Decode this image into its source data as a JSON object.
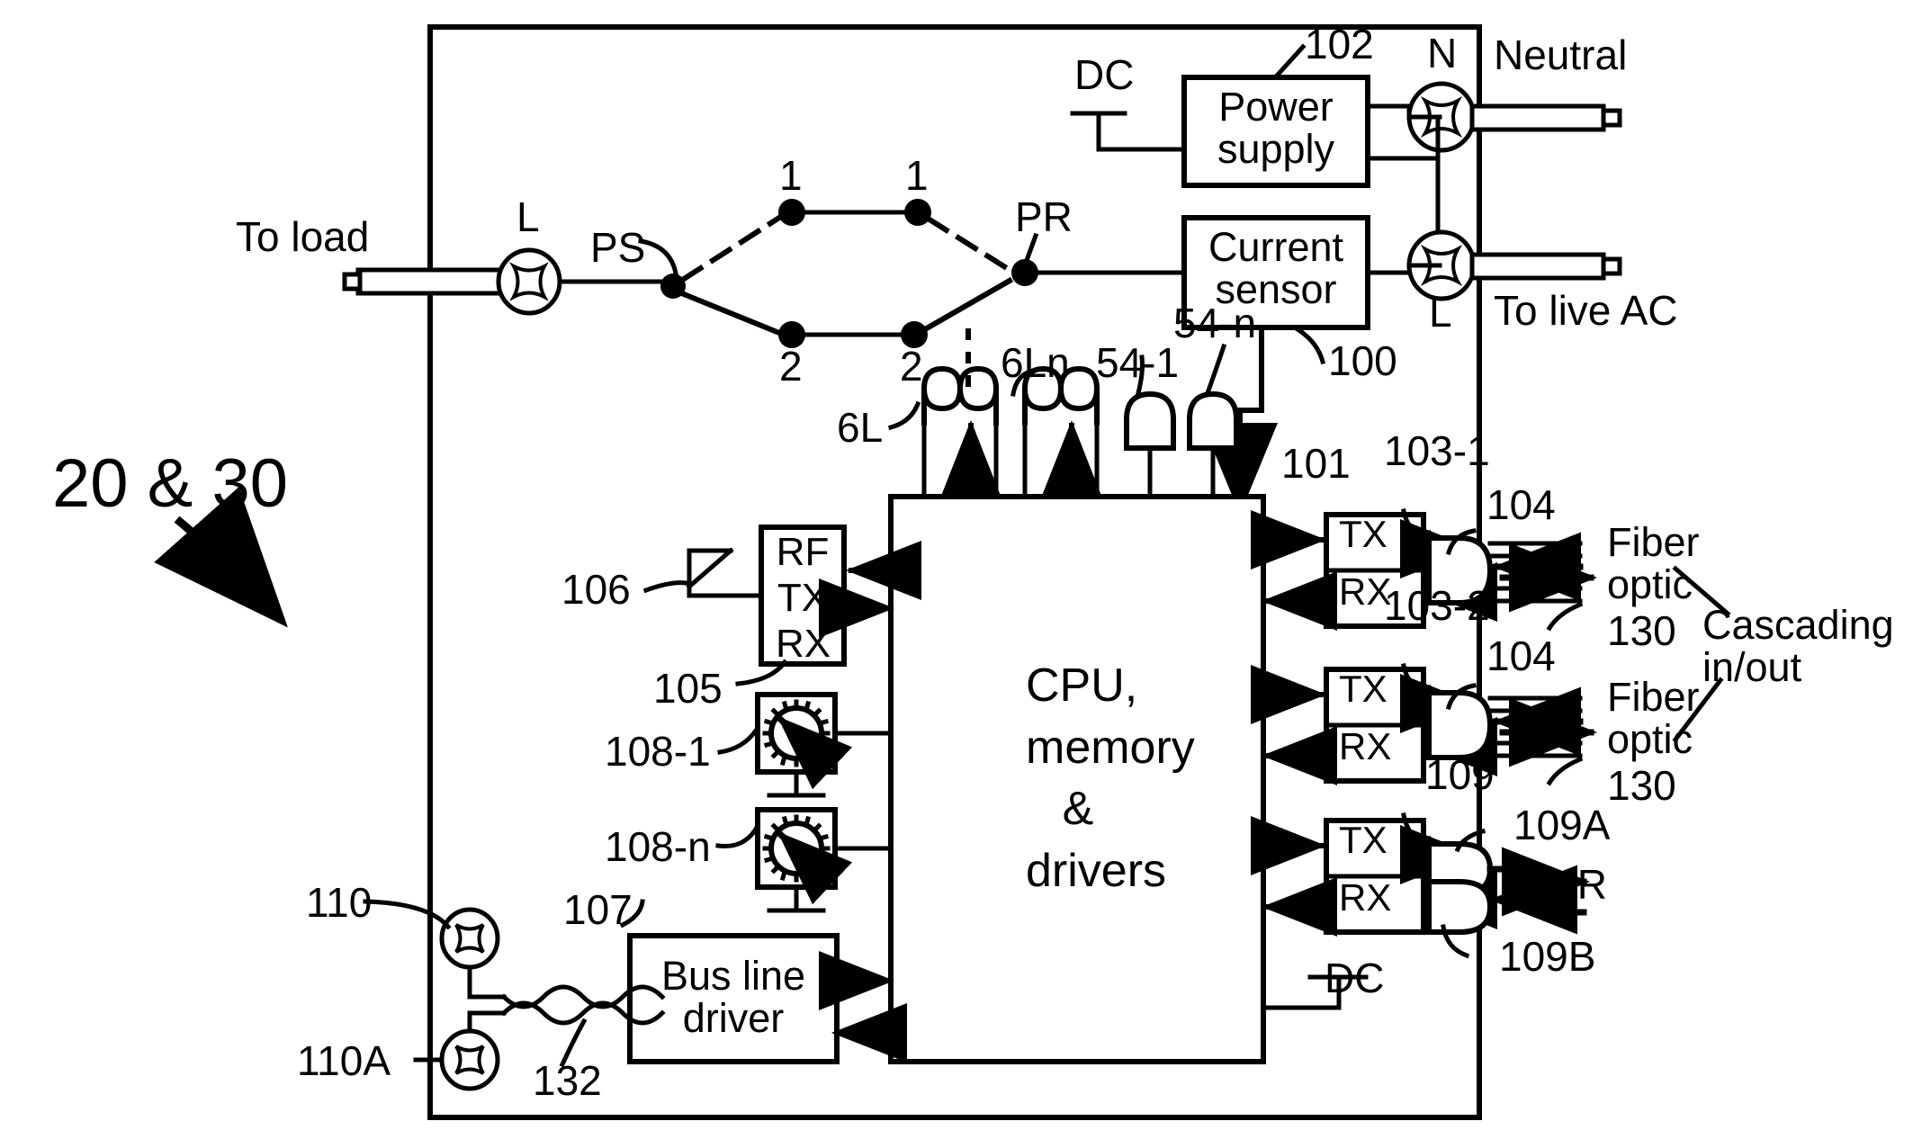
{
  "diagram": {
    "figure_ref": "20 & 30",
    "enclosure": {
      "name": "device-enclosure"
    },
    "power_line": {
      "to_load_label": "To load",
      "terminal_l_left_label": "L",
      "ps_label": "PS",
      "pr_label": "PR",
      "switch_pos_top_left": "1",
      "switch_pos_top_right": "1",
      "switch_pos_bottom_left": "2",
      "switch_pos_bottom_right": "2"
    },
    "blocks": {
      "power_supply": {
        "label": "Power\nsupply",
        "ref": "102"
      },
      "current_sensor": {
        "label": "Current\nsensor",
        "ref": "100"
      },
      "cpu": {
        "label": "CPU,\nmemory\n&\ndrivers"
      },
      "rf_module": {
        "label": "RF\nTX\nRX",
        "ref": "105"
      },
      "bus_line_driver": {
        "label": "Bus line\ndriver",
        "ref": "107"
      }
    },
    "transceivers": [
      {
        "tx": "TX",
        "rx": "RX",
        "ref": "103-1",
        "connector_ref": "104",
        "media_label": "Fiber\noptic",
        "media_ref": "130"
      },
      {
        "tx": "TX",
        "rx": "RX",
        "ref": "103-2",
        "connector_ref": "104",
        "media_label": "Fiber\noptic",
        "media_ref": "130"
      },
      {
        "tx": "TX",
        "rx": "RX",
        "ref": "109",
        "emitter_ref": "109A",
        "receiver_ref": "109B",
        "media_label": "IR"
      }
    ],
    "ac_terminals": {
      "neutral_marker": "N",
      "neutral_label": "Neutral",
      "live_marker": "L",
      "live_label": "To live AC"
    },
    "dc_labels": {
      "power_supply_dc": "DC",
      "cpu_dc": "DC"
    },
    "coils": [
      {
        "label": "6L"
      },
      {
        "label": "6Ln"
      }
    ],
    "sensors": [
      {
        "label": "54-1"
      },
      {
        "label": "54-n"
      }
    ],
    "io_refs": {
      "cpu_bus_ref": "101",
      "antenna_ref": "106",
      "dial_1_ref": "108-1",
      "dial_n_ref": "108-n",
      "terminal_110": "110",
      "terminal_110A": "110A",
      "twisted_pair_ref": "132"
    },
    "cascading_label": "Cascading\nin/out",
    "colors": {
      "ink": "#000000",
      "paper": "#ffffff"
    }
  }
}
